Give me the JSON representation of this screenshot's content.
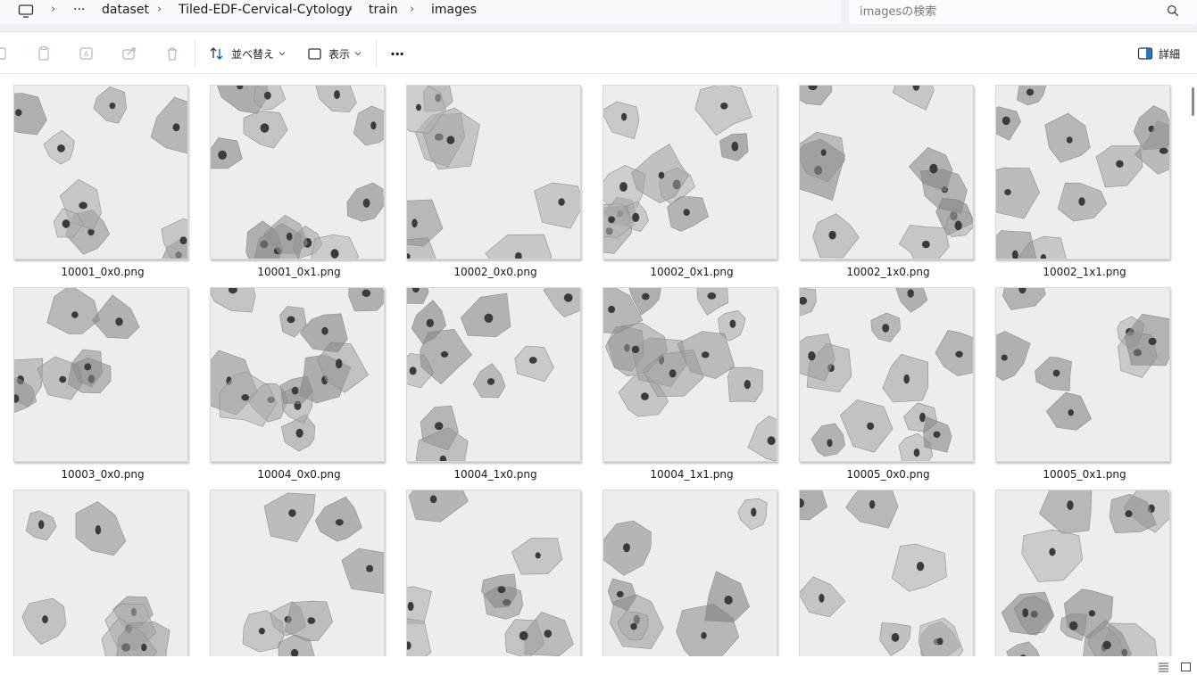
{
  "breadcrumb": {
    "overflow": "···",
    "items": [
      "dataset",
      "Tiled-EDF-Cervical-Cytology",
      "train",
      "images"
    ]
  },
  "search": {
    "placeholder": "imagesの検索"
  },
  "toolbar": {
    "sort_label": "並べ替え",
    "view_label": "表示",
    "more_label": "···",
    "details_label": "詳細"
  },
  "files": [
    {
      "name": "10001_0x0.png"
    },
    {
      "name": "10001_0x1.png"
    },
    {
      "name": "10002_0x0.png"
    },
    {
      "name": "10002_0x1.png"
    },
    {
      "name": "10002_1x0.png"
    },
    {
      "name": "10002_1x1.png"
    },
    {
      "name": "10003_0x0.png"
    },
    {
      "name": "10004_0x0.png"
    },
    {
      "name": "10004_1x0.png"
    },
    {
      "name": "10004_1x1.png"
    },
    {
      "name": "10005_0x0.png"
    },
    {
      "name": "10005_0x1.png"
    },
    {
      "name": ""
    },
    {
      "name": ""
    },
    {
      "name": ""
    },
    {
      "name": ""
    },
    {
      "name": ""
    },
    {
      "name": ""
    }
  ],
  "colors": {
    "accent": "#005fb8",
    "address_bg": "#eef2f8",
    "cell_bg": "#ededed"
  },
  "icons": [
    "monitor-icon",
    "chevron-right-icon",
    "search-icon",
    "cut-icon",
    "copy-icon",
    "rename-icon",
    "share-icon",
    "delete-icon",
    "sort-icon",
    "view-icon",
    "chevron-down-icon",
    "more-icon",
    "details-pane-icon",
    "list-view-icon",
    "tiles-view-icon"
  ]
}
